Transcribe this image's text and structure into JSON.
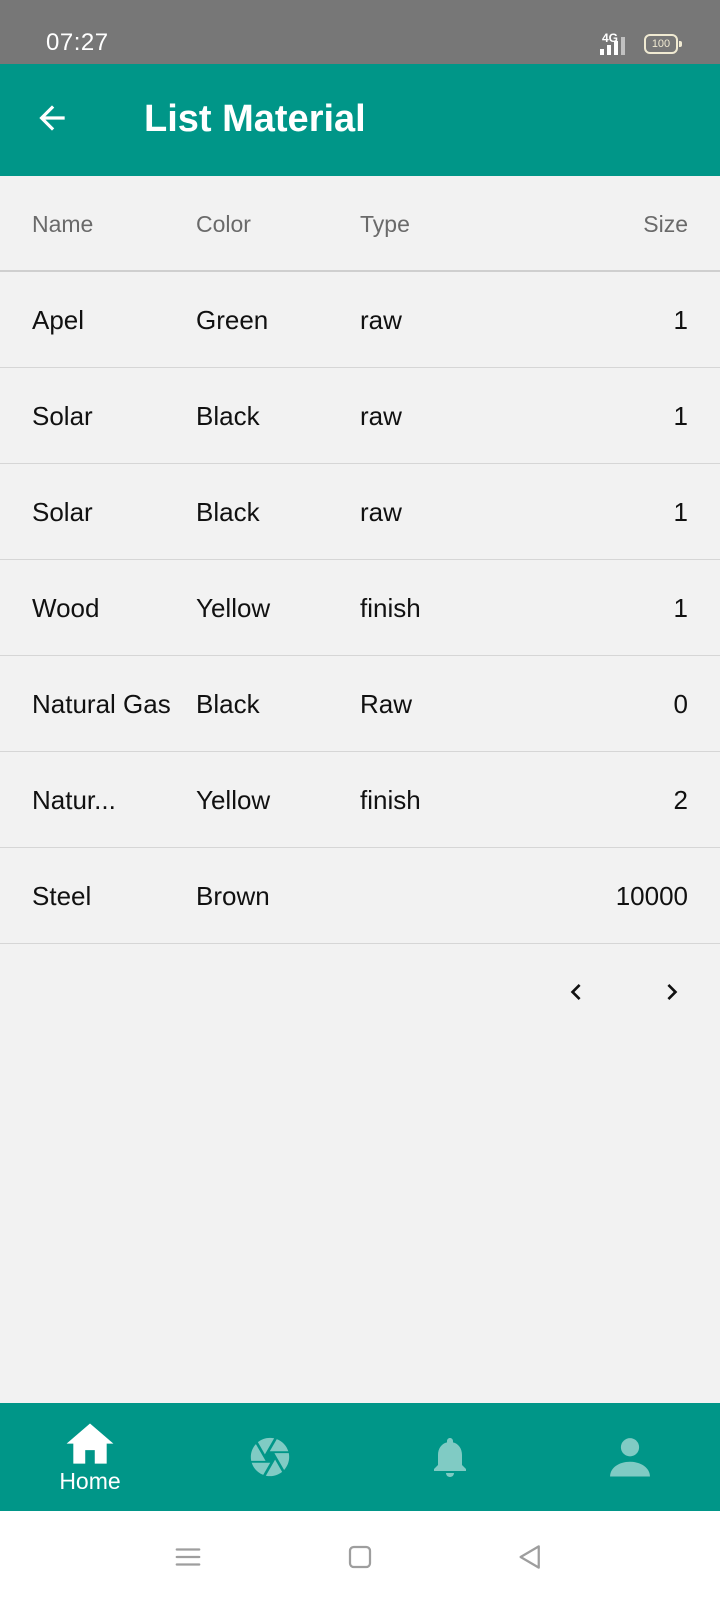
{
  "status_bar": {
    "time": "07:27",
    "network": "4G",
    "battery": "100"
  },
  "app_bar": {
    "back_icon": "arrow-left-icon",
    "title": "List Material"
  },
  "table": {
    "headers": {
      "name": "Name",
      "color": "Color",
      "type": "Type",
      "size": "Size"
    },
    "rows": [
      {
        "name": "Apel",
        "color": "Green",
        "type": "raw",
        "size": "1"
      },
      {
        "name": "Solar",
        "color": "Black",
        "type": "raw",
        "size": "1"
      },
      {
        "name": "Solar",
        "color": "Black",
        "type": "raw",
        "size": "1"
      },
      {
        "name": "Wood",
        "color": "Yellow",
        "type": "finish",
        "size": "1"
      },
      {
        "name": "Natural Gas",
        "color": "Black",
        "type": "Raw",
        "size": "0"
      },
      {
        "name": "Natur...",
        "color": "Yellow",
        "type": "finish",
        "size": "2"
      },
      {
        "name": "Steel",
        "color": "Brown",
        "type": "",
        "size": "10000"
      }
    ]
  },
  "pagination": {
    "prev_icon": "chevron-left-icon",
    "next_icon": "chevron-right-icon"
  },
  "bottom_nav": {
    "items": [
      {
        "label": "Home",
        "icon": "home-icon",
        "active": true
      },
      {
        "label": "",
        "icon": "camera-aperture-icon",
        "active": false
      },
      {
        "label": "",
        "icon": "bell-icon",
        "active": false
      },
      {
        "label": "",
        "icon": "person-icon",
        "active": false
      }
    ]
  },
  "system_nav": {
    "menu_icon": "menu-icon",
    "home_icon": "square-home-icon",
    "back_icon": "triangle-back-icon"
  },
  "colors": {
    "primary": "#009688",
    "status_bar": "#777777",
    "background": "#f2f2f2",
    "inactive_icon": "#80cbc4"
  }
}
